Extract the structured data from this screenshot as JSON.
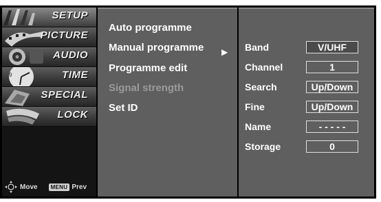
{
  "tabs": [
    {
      "label": "SETUP",
      "icon": "setup-icon"
    },
    {
      "label": "PICTURE",
      "icon": "picture-icon"
    },
    {
      "label": "AUDIO",
      "icon": "audio-icon"
    },
    {
      "label": "TIME",
      "icon": "time-icon"
    },
    {
      "label": "SPECIAL",
      "icon": "special-icon"
    },
    {
      "label": "LOCK",
      "icon": "lock-icon"
    }
  ],
  "help": {
    "move": "Move",
    "menu_key": "MENU",
    "prev": "Prev"
  },
  "menu": {
    "items": [
      {
        "label": "Auto programme",
        "state": "normal"
      },
      {
        "label": "Manual programme",
        "state": "selected"
      },
      {
        "label": "Programme edit",
        "state": "normal"
      },
      {
        "label": "Signal strength",
        "state": "disabled"
      },
      {
        "label": "Set ID",
        "state": "normal"
      }
    ],
    "arrow": "▶"
  },
  "manual": {
    "fields": [
      {
        "label": "Band",
        "value": "V/UHF"
      },
      {
        "label": "Channel",
        "value": "1"
      },
      {
        "label": "Search",
        "value": "Up/Down"
      },
      {
        "label": "Fine",
        "value": "Up/Down"
      },
      {
        "label": "Name",
        "value": "- - - - -"
      },
      {
        "label": "Storage",
        "value": "0"
      }
    ]
  }
}
